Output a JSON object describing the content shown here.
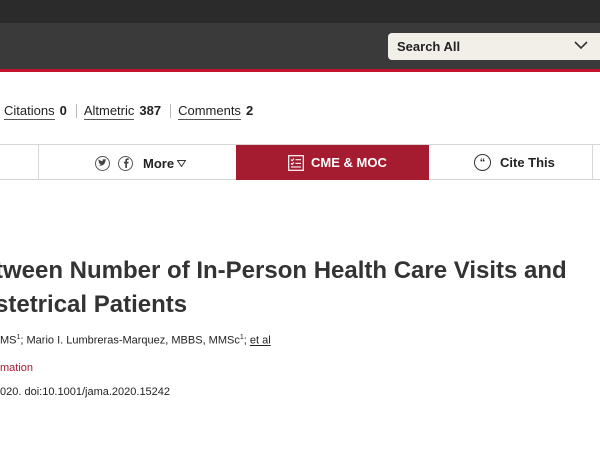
{
  "header": {
    "search_scope": "Search All"
  },
  "metrics": [
    {
      "label": "Citations",
      "value": "0"
    },
    {
      "label": "Altmetric",
      "value": "387"
    },
    {
      "label": "Comments",
      "value": "2"
    }
  ],
  "actions": {
    "more_label": "More",
    "cme_label": "CME & MOC",
    "cite_label": "Cite This"
  },
  "article": {
    "title_line1": "tween Number of In-Person Health Care Visits and",
    "title_line2": "stetrical Patients",
    "author_prefix": "MS",
    "author_sup1": "1",
    "author_main": "; Mario I. Lumbreras-Marquez, MBBS, MMSc",
    "author_sup2": "1",
    "author_sep": "; ",
    "et_al": "et al",
    "info_link": "mation",
    "citation": "020. doi:10.1001/jama.2020.15242"
  },
  "colors": {
    "brand_red": "#a51c30",
    "top_bar": "#2b2b2b",
    "search_band": "#3a3a3a"
  }
}
